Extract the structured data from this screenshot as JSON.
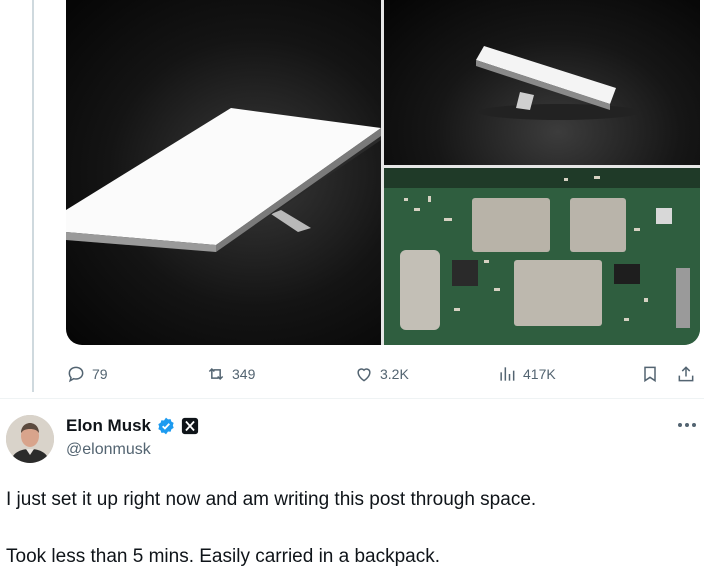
{
  "previous_tweet": {
    "media": [
      {
        "icon": "starlink-dish-large-photo"
      },
      {
        "icon": "starlink-dish-small-photo"
      },
      {
        "icon": "circuit-board-photo"
      }
    ],
    "actions": {
      "reply_count": "79",
      "repost_count": "349",
      "like_count": "3.2K",
      "view_count": "417K"
    }
  },
  "tweet": {
    "author_name": "Elon Musk",
    "author_handle": "@elonmusk",
    "verified": true,
    "affiliation_badge": "X",
    "text_line_1": "I just set it up right now and am writing this post through space.",
    "text_line_2": "Took less than 5 mins. Easily carried in a backpack."
  },
  "colors": {
    "text_primary": "#0f1419",
    "text_secondary": "#536471",
    "verified_blue": "#1d9bf0",
    "thread_line": "#cfd9de"
  }
}
